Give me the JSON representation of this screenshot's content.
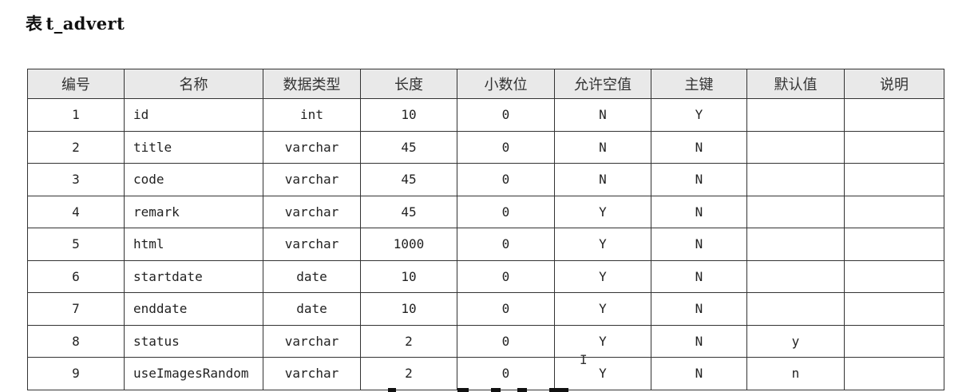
{
  "title": {
    "prefix": "表",
    "table_name": "t_advert"
  },
  "columns": [
    "编号",
    "名称",
    "数据类型",
    "长度",
    "小数位",
    "允许空值",
    "主键",
    "默认值",
    "说明"
  ],
  "rows": [
    {
      "no": "1",
      "name": "id",
      "type": "int",
      "length": "10",
      "scale": "0",
      "nullable": "N",
      "pk": "Y",
      "default": "",
      "desc": ""
    },
    {
      "no": "2",
      "name": "title",
      "type": "varchar",
      "length": "45",
      "scale": "0",
      "nullable": "N",
      "pk": "N",
      "default": "",
      "desc": ""
    },
    {
      "no": "3",
      "name": "code",
      "type": "varchar",
      "length": "45",
      "scale": "0",
      "nullable": "N",
      "pk": "N",
      "default": "",
      "desc": ""
    },
    {
      "no": "4",
      "name": "remark",
      "type": "varchar",
      "length": "45",
      "scale": "0",
      "nullable": "Y",
      "pk": "N",
      "default": "",
      "desc": ""
    },
    {
      "no": "5",
      "name": "html",
      "type": "varchar",
      "length": "1000",
      "scale": "0",
      "nullable": "Y",
      "pk": "N",
      "default": "",
      "desc": ""
    },
    {
      "no": "6",
      "name": "startdate",
      "type": "date",
      "length": "10",
      "scale": "0",
      "nullable": "Y",
      "pk": "N",
      "default": "",
      "desc": ""
    },
    {
      "no": "7",
      "name": "enddate",
      "type": "date",
      "length": "10",
      "scale": "0",
      "nullable": "Y",
      "pk": "N",
      "default": "",
      "desc": ""
    },
    {
      "no": "8",
      "name": "status",
      "type": "varchar",
      "length": "2",
      "scale": "0",
      "nullable": "Y",
      "pk": "N",
      "default": "y",
      "desc": ""
    },
    {
      "no": "9",
      "name": "useImagesRandom",
      "type": "varchar",
      "length": "2",
      "scale": "0",
      "nullable": "Y",
      "pk": "N",
      "default": "n",
      "desc": ""
    }
  ],
  "cursor": {
    "icon": "text-cursor-icon",
    "glyph": "I"
  },
  "colors": {
    "header_bg": "#e9e9e9",
    "border": "#333333"
  }
}
